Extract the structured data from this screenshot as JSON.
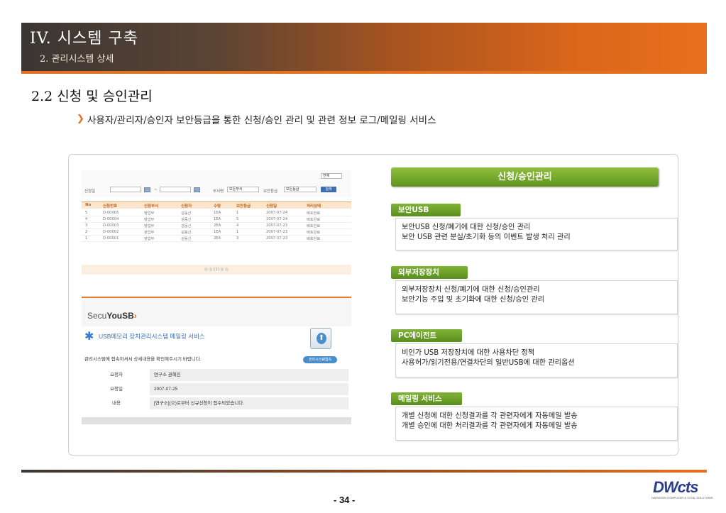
{
  "header": {
    "title": "IV. 시스템 구축",
    "subtitle": "2.  관리시스템 상세"
  },
  "section": {
    "title": "2.2 신청 및 승인관리",
    "bullet": "사용자/관리자/승인자 보안등급을 통한 신청/승인 관리 및 관련 정보 로그/메일링 서비스"
  },
  "screenshot": {
    "filter": {
      "apply_date_label": "신청일",
      "dept_label": "부서명",
      "dept_value": "모든부서",
      "level_label": "보안등급",
      "level_value": "모든등급",
      "scope_value": "전체",
      "search_button": "검색",
      "range_sep": "~"
    },
    "columns": [
      "No",
      "신청번호",
      "신청부서",
      "신청자",
      "수량",
      "보안등급",
      "신청일",
      "처리상태"
    ],
    "rows": [
      [
        "5",
        "D-00005",
        "영업부",
        "김동신",
        "1EA",
        "1",
        "2007-07-24",
        "배포완료"
      ],
      [
        "4",
        "D-00004",
        "영업부",
        "김동신",
        "1EA",
        "5",
        "2007-07-24",
        "배포완료"
      ],
      [
        "3",
        "D-00003",
        "영업부",
        "김동신",
        "2EA",
        "4",
        "2007-07-23",
        "배포완료"
      ],
      [
        "2",
        "D-00002",
        "영업부",
        "김동신",
        "1EA",
        "1",
        "2007-07-23",
        "배포완료"
      ],
      [
        "1",
        "D-00001",
        "영업부",
        "김동신",
        "2EA",
        "3",
        "2007-07-23",
        "배포완료"
      ]
    ],
    "pager": "◎ ◎ [1] ◎ ◎"
  },
  "mail": {
    "logo_prefix": "Secu",
    "logo_bold": "YouSB",
    "logo_mark": "›",
    "service_title": "USB메모리 장치관리시스템 메일링 서비스",
    "description": "관리시스템에 접속하셔서 상세내용을 확인해주시기 바랍니다.",
    "badge": "관리시스템접속",
    "fields": [
      {
        "label": "요청자",
        "value": "연구소 권혜진"
      },
      {
        "label": "요청일",
        "value": "2007-07-25"
      },
      {
        "label": "내용",
        "value": "[연구소](으)로부터 신규신청이 접수되었습니다."
      }
    ]
  },
  "panel": {
    "header": "신청/승인관리",
    "items": [
      {
        "tag": "보안USB",
        "lines": [
          "보안USB 신청/폐기에 대한 신청/승인 관리",
          "보안 USB 관련 분실/초기화 등의 이벤트 발생 처리 관리"
        ]
      },
      {
        "tag": "외부저장장치",
        "lines": [
          "외부저장장치 신청/폐기에 대한 신청/승인관리",
          "보안기능 주입 및 초기화에 대한 신청/승인 관리"
        ]
      },
      {
        "tag": "PC에이전트",
        "lines": [
          "비인가 USB 저장장치에 대한 사용차단 정책",
          "사용허가/읽기전용/연결차단의 일반USB에 대한 관리옵션"
        ]
      },
      {
        "tag": "메일링 서비스",
        "lines": [
          "개별 신청에 대한 신청결과를 각 관련자에게 자동메일 발송",
          "개별 승인에 대한 처리결과를 각 관련자에게 자동메일 발송"
        ]
      }
    ]
  },
  "footer": {
    "page": "- 34 -",
    "logo": "DWcts",
    "logo_sub": "DAEWOON COMPUTER & TOTAL SOLUTIONS"
  },
  "colors": {
    "accent_orange": "#e2701f",
    "accent_green": "#6fa52b",
    "link_blue": "#3a6fb8"
  }
}
